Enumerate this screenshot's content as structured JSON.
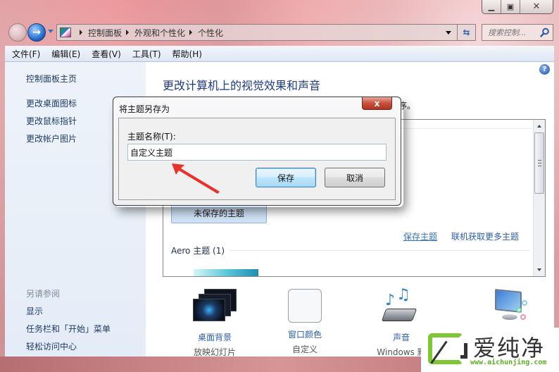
{
  "window": {
    "caption_buttons": [
      "minimize",
      "maximize",
      "close"
    ]
  },
  "nav": {
    "back_icon": "back-arrow-icon",
    "forward_icon": "forward-arrow-icon",
    "breadcrumbs": [
      "控制面板",
      "外观和个性化",
      "个性化"
    ],
    "search_placeholder": "搜索控制...",
    "refresh_icon": "refresh-icon",
    "search_icon": "magnifier-icon"
  },
  "menubar": {
    "items": [
      "文件(F)",
      "编辑(E)",
      "查看(V)",
      "工具(T)",
      "帮助(H)"
    ]
  },
  "sidebar": {
    "home_link": "控制面板主页",
    "links": [
      "更改桌面图标",
      "更改鼠标指针",
      "更改帐户图片"
    ],
    "see_also_heading": "另请参阅",
    "see_also_links": [
      "显示",
      "任务栏和「开始」菜单",
      "轻松访问中心"
    ]
  },
  "main": {
    "help_icon": "?",
    "title": "更改计算机上的视觉效果和声音",
    "subtitle_tail": "序。",
    "unsaved_theme": "未保存的主题",
    "save_theme_link": "保存主题",
    "get_more_link": "联机获取更多主题",
    "aero_group": "Aero 主题 (1)",
    "bottom_items": [
      {
        "name": "桌面背景",
        "value": "放映幻灯片",
        "icon": "desktop-background-icon"
      },
      {
        "name": "窗口颜色",
        "value": "自定义",
        "icon": "window-color-icon"
      },
      {
        "name": "声音",
        "value": "Windows 默",
        "icon": "sound-icon"
      },
      {
        "name": "",
        "value": "",
        "icon": "screensaver-icon"
      }
    ]
  },
  "dialog": {
    "title": "将主题另存为",
    "close_label": "x",
    "field_label": "主题名称(T):",
    "field_value": "自定义主题",
    "save_label": "保存",
    "cancel_label": "取消"
  },
  "watermark": {
    "brand": "爱纯净",
    "url": "www.aichunjing.com",
    "accent_color": "#7dc832"
  }
}
